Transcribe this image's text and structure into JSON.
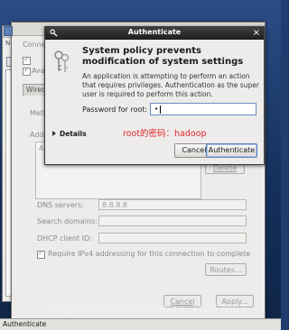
{
  "edit_window": {
    "fragments": {
      "connection_label": "Conne",
      "available_label": "Ava",
      "tab_wired": "Wired",
      "method_label": "Meth",
      "addresses_label": "Add",
      "address_col": "A",
      "delete_label": "Delete"
    },
    "dns_servers_label": "DNS servers:",
    "dns_servers_value": "8.8.8.8",
    "search_domains_label": "Search domains:",
    "search_domains_value": "",
    "dhcp_client_id_label": "DHCP client ID:",
    "dhcp_client_id_value": "",
    "require_ipv4_label": "Require IPv4 addressing for this connection to complete",
    "routes_label": "Routes...",
    "cancel_label": "Cancel",
    "apply_label": "Apply..."
  },
  "back_window": {
    "marker": "N"
  },
  "auth_dialog": {
    "title": "Authenticate",
    "heading": "System policy prevents modification of system settings",
    "description": "An application is attempting to perform an action that requires privileges. Authentication as the super user is required to perform this action.",
    "password_label": "Password for root:",
    "password_value": "•",
    "details_label": "Details",
    "annotation": "root的密码：hadoop",
    "cancel_label": "Cancel",
    "authenticate_label": "Authenticate"
  },
  "taskbar": {
    "task_label": "Authenticate"
  },
  "watermark": "https://blog.csdn.net/qq_31057867",
  "colors": {
    "annotation": "#e0262a",
    "titlebar": "#2a2a2a",
    "default_button_border": "#5a7fb6"
  }
}
